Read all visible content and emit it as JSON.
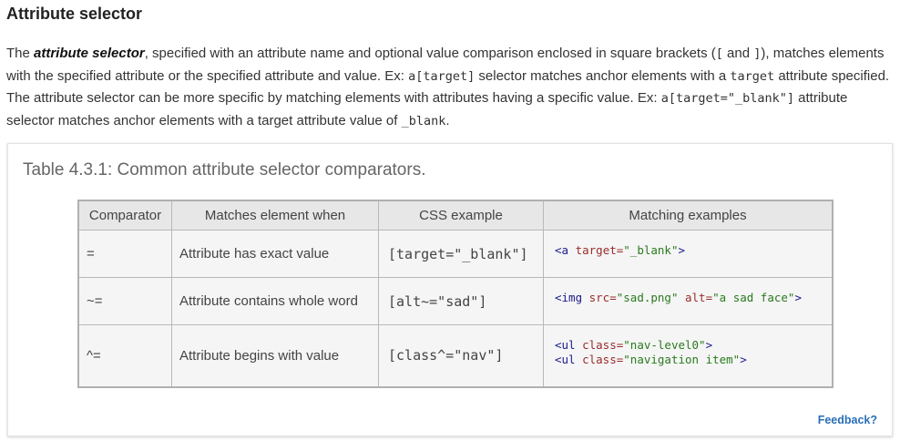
{
  "heading": "Attribute selector",
  "intro": {
    "p1": "The ",
    "term": "attribute selector",
    "p2": ", specified with an attribute name and optional value comparison enclosed in square brackets (",
    "code_open": "[",
    "p3": " and ",
    "code_close": "]",
    "p4": "), matches elements with the specified attribute or the specified attribute and value. Ex: ",
    "code_ex1": "a[target]",
    "p5": " selector matches anchor elements with a ",
    "code_target": "target",
    "p6": " attribute specified. The attribute selector can be more specific by matching elements with attributes having a specific value. Ex: ",
    "code_ex2": "a[target=\"_blank\"]",
    "p7": " attribute selector matches anchor elements with a target attribute value of ",
    "code_blank": "_blank",
    "p8": "."
  },
  "table": {
    "caption": "Table 4.3.1: Common attribute selector comparators.",
    "headers": [
      "Comparator",
      "Matches element when",
      "CSS example",
      "Matching examples"
    ],
    "rows": [
      {
        "comparator": "=",
        "when": "Attribute has exact value",
        "css": "[target=\"_blank\"]",
        "ex1": {
          "open": "<a",
          "attr": " target=",
          "val": "\"_blank\"",
          "close": ">"
        }
      },
      {
        "comparator": "~=",
        "when": "Attribute contains whole word",
        "css": "[alt~=\"sad\"]",
        "ex1": {
          "open": "<img",
          "attr": " src=",
          "val": "\"sad.png\"",
          "attr2": " alt=",
          "val2": "\"a sad face\"",
          "close": ">"
        }
      },
      {
        "comparator": "^=",
        "when": "Attribute begins with value",
        "css": "[class^=\"nav\"]",
        "ex1": {
          "open": "<ul",
          "attr": " class=",
          "val": "\"nav-level0\"",
          "close": ">"
        },
        "ex2": {
          "open": "<ul",
          "attr": " class=",
          "val": "\"navigation item\"",
          "close": ">"
        }
      }
    ]
  },
  "feedback": "Feedback?"
}
